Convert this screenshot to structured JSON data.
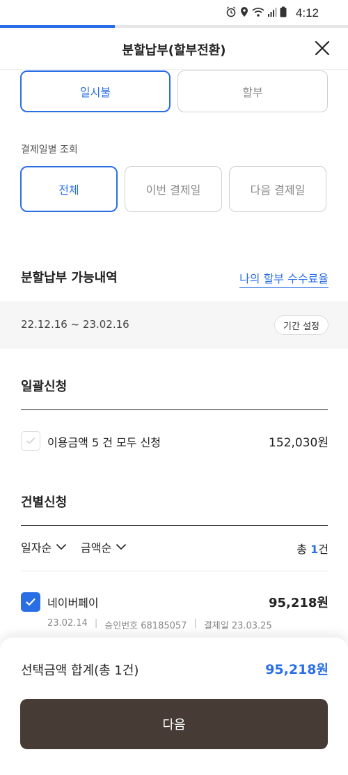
{
  "status_bar": {
    "time": "4:12"
  },
  "progress": {
    "fraction": 0.33
  },
  "header": {
    "title": "분할납부(할부전환)"
  },
  "type_toggle": {
    "options": [
      "일시불",
      "할부"
    ],
    "selected": "일시불"
  },
  "date_filter": {
    "label": "결제일별 조회",
    "options": [
      "전체",
      "이번 결제일",
      "다음 결제일"
    ],
    "selected": "전체"
  },
  "eligible": {
    "title": "분할납부 가능내역",
    "fee_link": "나의 할부 수수료율"
  },
  "period": {
    "range": "22.12.16 ~ 23.02.16",
    "button": "기간 설정"
  },
  "bulk": {
    "title": "일괄신청",
    "row_label": "이용금액 5 건 모두 신청",
    "row_amount": "152,030원",
    "checked": false
  },
  "individual": {
    "title": "건별신청",
    "sort_date": "일자순",
    "sort_amount": "금액순",
    "count_prefix": "총",
    "count_value": "1",
    "count_suffix": "건",
    "items": [
      {
        "merchant": "네이버페이",
        "amount": "95,218원",
        "date": "23.02.14",
        "approval": "승인번호 68185057",
        "payment_date": "결제일 23.03.25",
        "checked": true
      }
    ]
  },
  "summary": {
    "label": "선택금액 합계(총 1건)",
    "value": "95,218원"
  },
  "next_button": {
    "label": "다음"
  },
  "colors": {
    "accent": "#2a6ee6",
    "primary_button": "#463b35"
  }
}
